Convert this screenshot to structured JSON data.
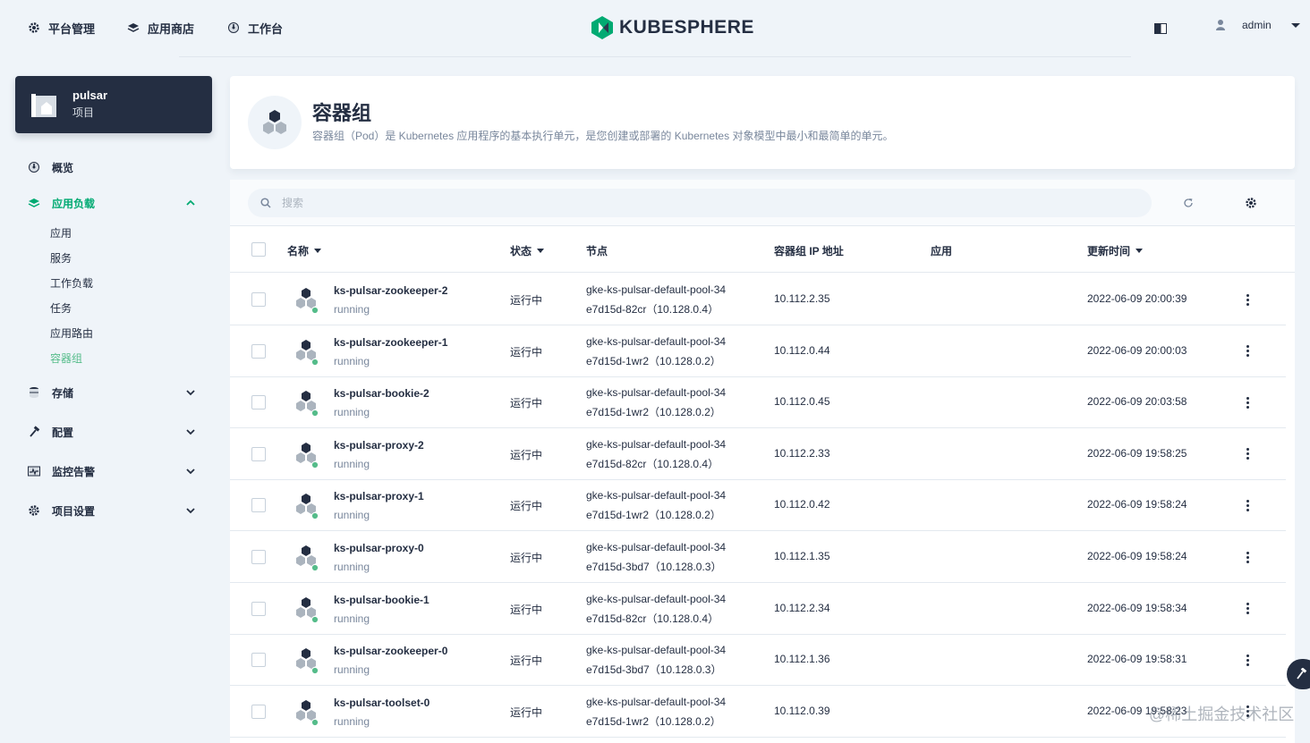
{
  "topnav": {
    "platform": "平台管理",
    "appstore": "应用商店",
    "workbench": "工作台",
    "logo": "KUBESPHERE",
    "user": "admin"
  },
  "project": {
    "name": "pulsar",
    "type": "项目"
  },
  "menu": {
    "overview": "概览",
    "workloads": "应用负载",
    "sub": [
      "应用",
      "服务",
      "工作负载",
      "任务",
      "应用路由",
      "容器组"
    ],
    "storage": "存储",
    "config": "配置",
    "monitoring": "监控告警",
    "settings": "项目设置"
  },
  "header": {
    "title": "容器组",
    "desc": "容器组（Pod）是 Kubernetes 应用程序的基本执行单元，是您创建或部署的 Kubernetes 对象模型中最小和最简单的单元。"
  },
  "search": {
    "placeholder": "搜索"
  },
  "columns": {
    "name": "名称",
    "status": "状态",
    "node": "节点",
    "ip": "容器组 IP 地址",
    "app": "应用",
    "updated": "更新时间"
  },
  "pods": [
    {
      "name": "ks-pulsar-zookeeper-2",
      "status": "running",
      "state": "运行中",
      "node1": "gke-ks-pulsar-default-pool-34",
      "node2": "e7d15d-82cr（10.128.0.4）",
      "ip": "10.112.2.35",
      "time": "2022-06-09 20:00:39"
    },
    {
      "name": "ks-pulsar-zookeeper-1",
      "status": "running",
      "state": "运行中",
      "node1": "gke-ks-pulsar-default-pool-34",
      "node2": "e7d15d-1wr2（10.128.0.2）",
      "ip": "10.112.0.44",
      "time": "2022-06-09 20:00:03"
    },
    {
      "name": "ks-pulsar-bookie-2",
      "status": "running",
      "state": "运行中",
      "node1": "gke-ks-pulsar-default-pool-34",
      "node2": "e7d15d-1wr2（10.128.0.2）",
      "ip": "10.112.0.45",
      "time": "2022-06-09 20:03:58"
    },
    {
      "name": "ks-pulsar-proxy-2",
      "status": "running",
      "state": "运行中",
      "node1": "gke-ks-pulsar-default-pool-34",
      "node2": "e7d15d-82cr（10.128.0.4）",
      "ip": "10.112.2.33",
      "time": "2022-06-09 19:58:25"
    },
    {
      "name": "ks-pulsar-proxy-1",
      "status": "running",
      "state": "运行中",
      "node1": "gke-ks-pulsar-default-pool-34",
      "node2": "e7d15d-1wr2（10.128.0.2）",
      "ip": "10.112.0.42",
      "time": "2022-06-09 19:58:24"
    },
    {
      "name": "ks-pulsar-proxy-0",
      "status": "running",
      "state": "运行中",
      "node1": "gke-ks-pulsar-default-pool-34",
      "node2": "e7d15d-3bd7（10.128.0.3）",
      "ip": "10.112.1.35",
      "time": "2022-06-09 19:58:24"
    },
    {
      "name": "ks-pulsar-bookie-1",
      "status": "running",
      "state": "运行中",
      "node1": "gke-ks-pulsar-default-pool-34",
      "node2": "e7d15d-82cr（10.128.0.4）",
      "ip": "10.112.2.34",
      "time": "2022-06-09 19:58:34"
    },
    {
      "name": "ks-pulsar-zookeeper-0",
      "status": "running",
      "state": "运行中",
      "node1": "gke-ks-pulsar-default-pool-34",
      "node2": "e7d15d-3bd7（10.128.0.3）",
      "ip": "10.112.1.36",
      "time": "2022-06-09 19:58:31"
    },
    {
      "name": "ks-pulsar-toolset-0",
      "status": "running",
      "state": "运行中",
      "node1": "gke-ks-pulsar-default-pool-34",
      "node2": "e7d15d-1wr2（10.128.0.2）",
      "ip": "10.112.0.39",
      "time": "2022-06-09 19:58:23"
    }
  ],
  "watermark": "@稀土掘金技术社区",
  "colors": {
    "accent": "#00aa72",
    "dark": "#242e42",
    "running": "#55bc8a"
  }
}
